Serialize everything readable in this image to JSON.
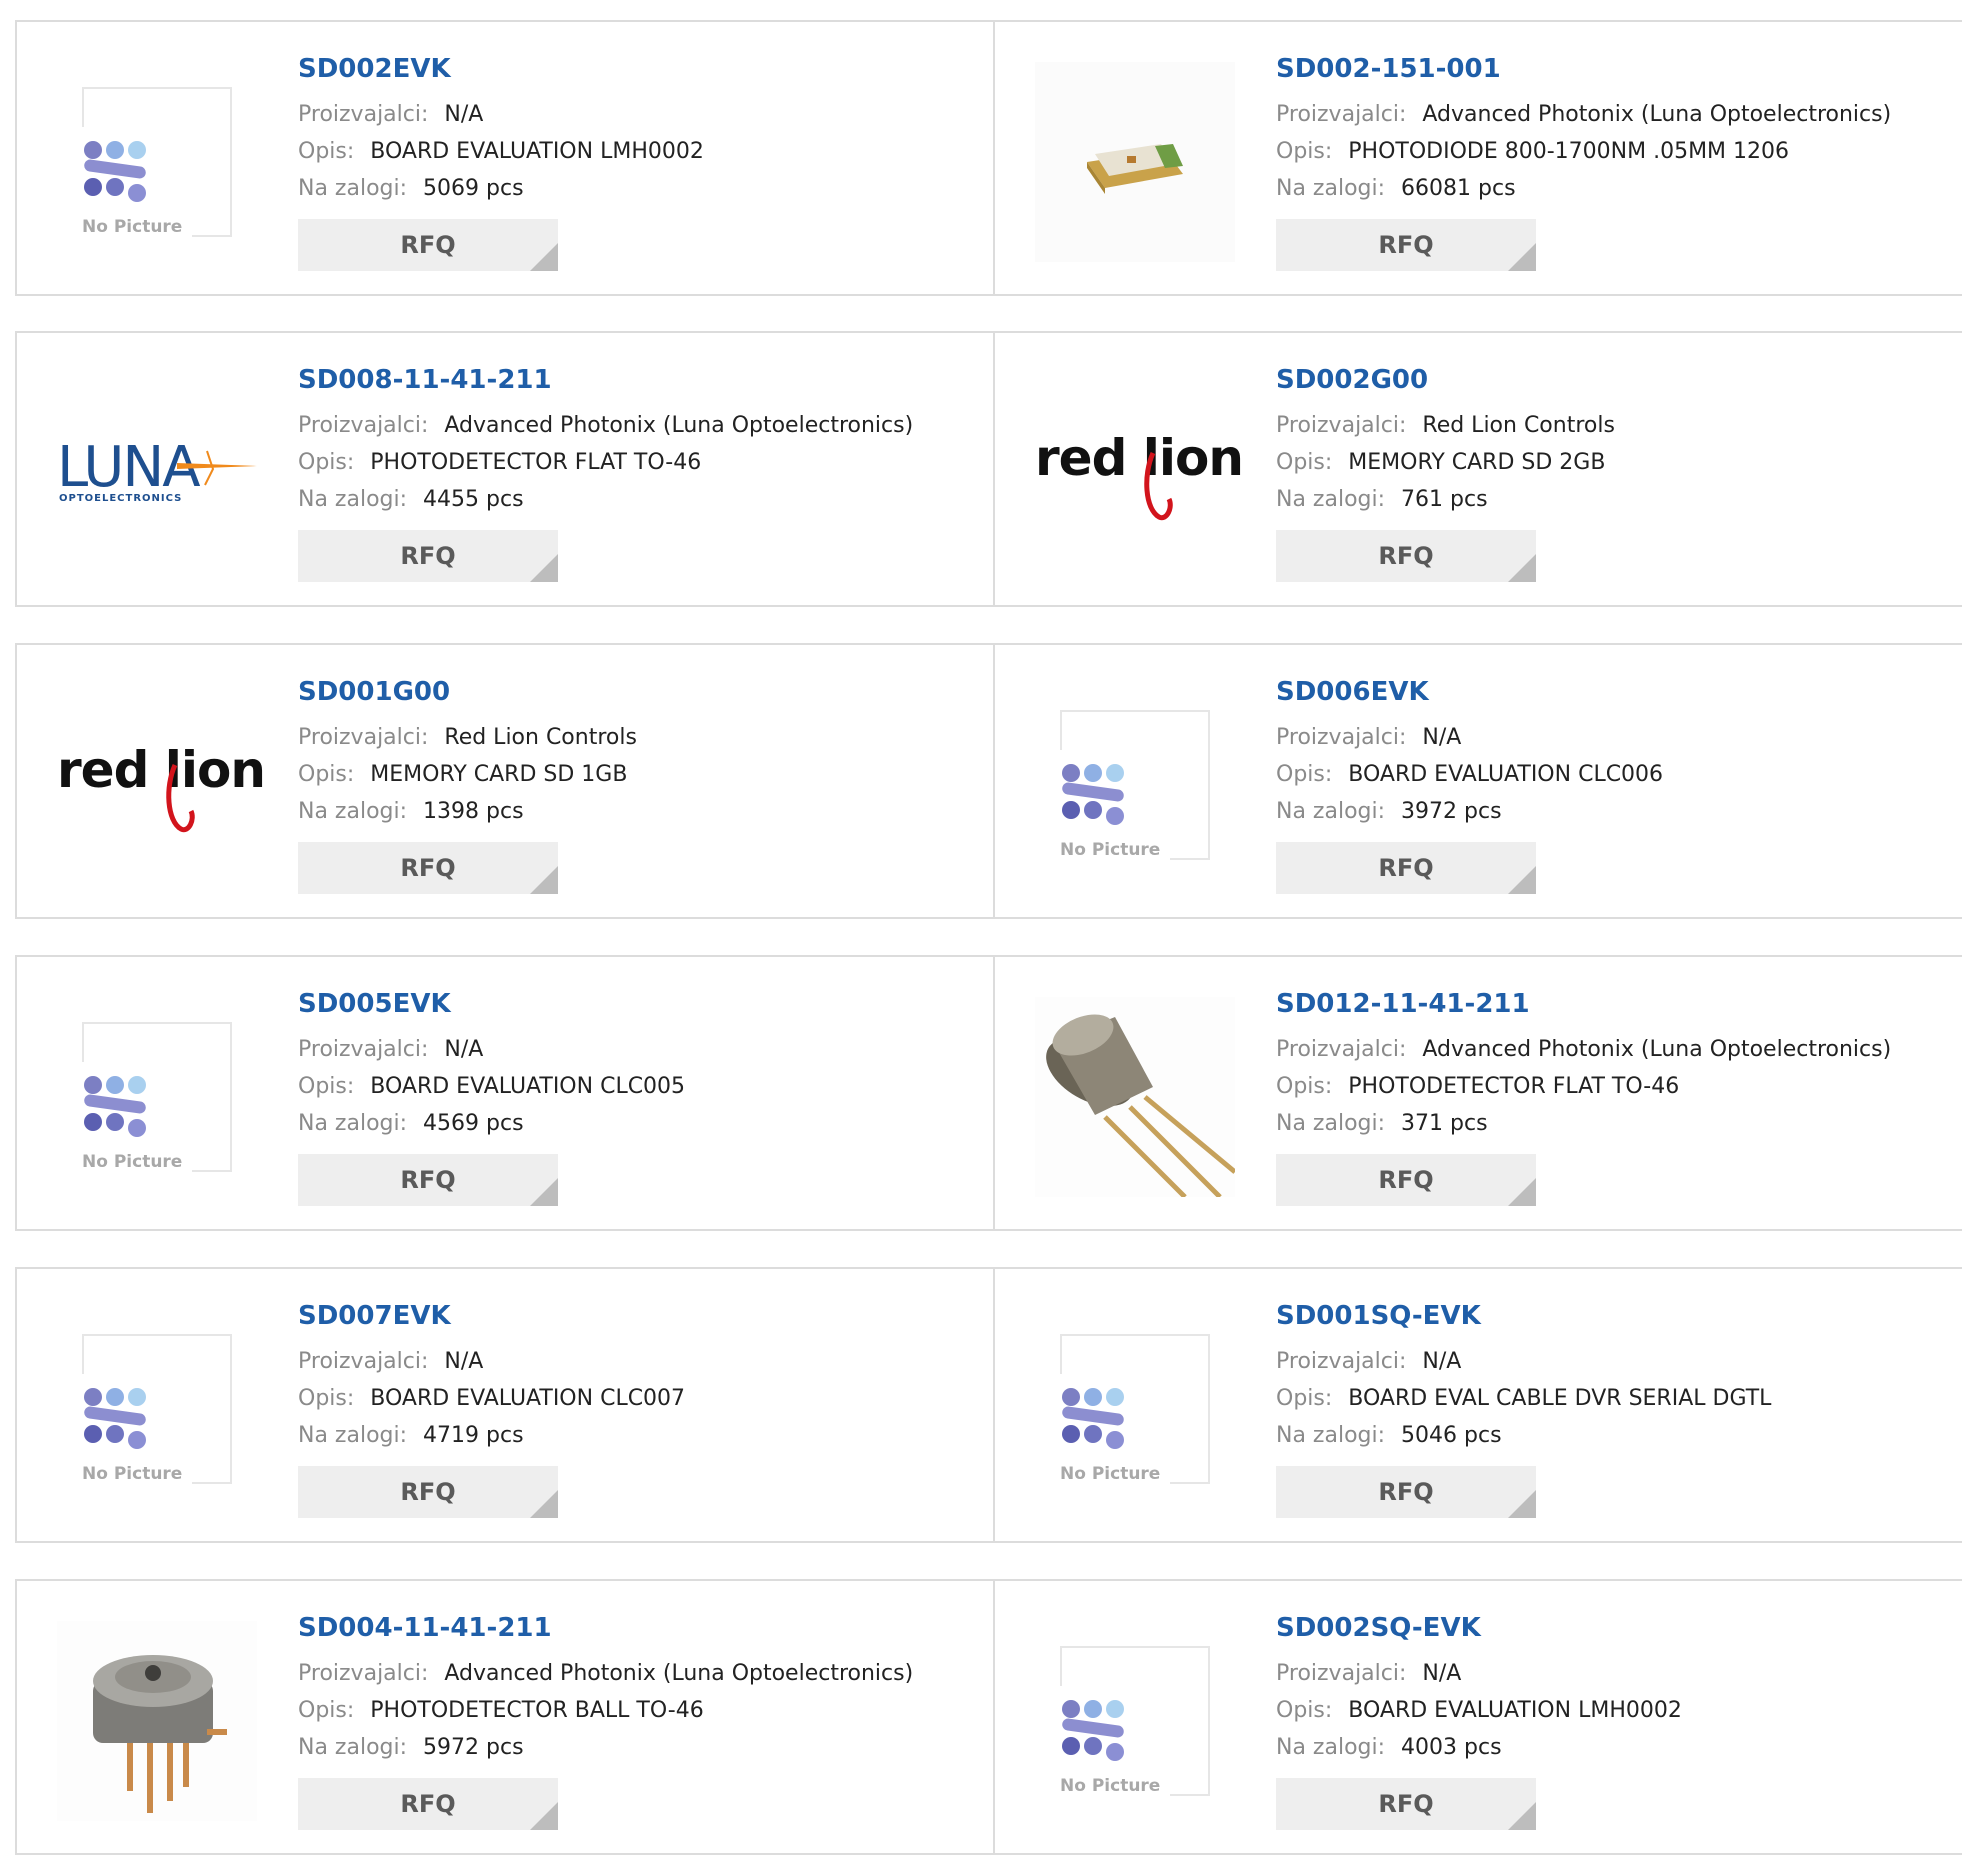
{
  "labels": {
    "manufacturer": "Proizvajalci:",
    "description": "Opis:",
    "stock": "Na zalogi:",
    "rfq": "RFQ"
  },
  "placeholder": {
    "no_picture_text": "No Picture"
  },
  "logos": {
    "red_lion_text": "red lion",
    "luna_text": "LUNA",
    "luna_sub": "OPTOELECTRONICS"
  },
  "colors": {
    "part_number": "#1f5ea8",
    "label": "#8a8a8a",
    "rfq_bg": "#eeeeee",
    "rfq_text": "#5a5a5a",
    "border": "#dcdcdc"
  },
  "products": [
    {
      "part_number": "SD002EVK",
      "manufacturer": "N/A",
      "description": "BOARD EVALUATION LMH0002",
      "stock": "5069 pcs",
      "image": "no-picture"
    },
    {
      "part_number": "SD002-151-001",
      "manufacturer": "Advanced Photonix (Luna Optoelectronics)",
      "description": "PHOTODIODE 800-1700NM .05MM 1206",
      "stock": "66081 pcs",
      "image": "smd-photodiode"
    },
    {
      "part_number": "SD008-11-41-211",
      "manufacturer": "Advanced Photonix (Luna Optoelectronics)",
      "description": "PHOTODETECTOR FLAT TO-46",
      "stock": "4455 pcs",
      "image": "luna-logo"
    },
    {
      "part_number": "SD002G00",
      "manufacturer": "Red Lion Controls",
      "description": "MEMORY CARD SD 2GB",
      "stock": "761 pcs",
      "image": "red-lion-logo"
    },
    {
      "part_number": "SD001G00",
      "manufacturer": "Red Lion Controls",
      "description": "MEMORY CARD SD 1GB",
      "stock": "1398 pcs",
      "image": "red-lion-logo"
    },
    {
      "part_number": "SD006EVK",
      "manufacturer": "N/A",
      "description": "BOARD EVALUATION CLC006",
      "stock": "3972 pcs",
      "image": "no-picture"
    },
    {
      "part_number": "SD005EVK",
      "manufacturer": "N/A",
      "description": "BOARD EVALUATION CLC005",
      "stock": "4569 pcs",
      "image": "no-picture"
    },
    {
      "part_number": "SD012-11-41-211",
      "manufacturer": "Advanced Photonix (Luna Optoelectronics)",
      "description": "PHOTODETECTOR FLAT TO-46",
      "stock": "371 pcs",
      "image": "to46-flat"
    },
    {
      "part_number": "SD007EVK",
      "manufacturer": "N/A",
      "description": "BOARD EVALUATION CLC007",
      "stock": "4719 pcs",
      "image": "no-picture"
    },
    {
      "part_number": "SD001SQ-EVK",
      "manufacturer": "N/A",
      "description": "BOARD EVAL CABLE DVR SERIAL DGTL",
      "stock": "5046 pcs",
      "image": "no-picture"
    },
    {
      "part_number": "SD004-11-41-211",
      "manufacturer": "Advanced Photonix (Luna Optoelectronics)",
      "description": "PHOTODETECTOR BALL TO-46",
      "stock": "5972 pcs",
      "image": "to46-ball"
    },
    {
      "part_number": "SD002SQ-EVK",
      "manufacturer": "N/A",
      "description": "BOARD EVALUATION LMH0002",
      "stock": "4003 pcs",
      "image": "no-picture"
    }
  ]
}
